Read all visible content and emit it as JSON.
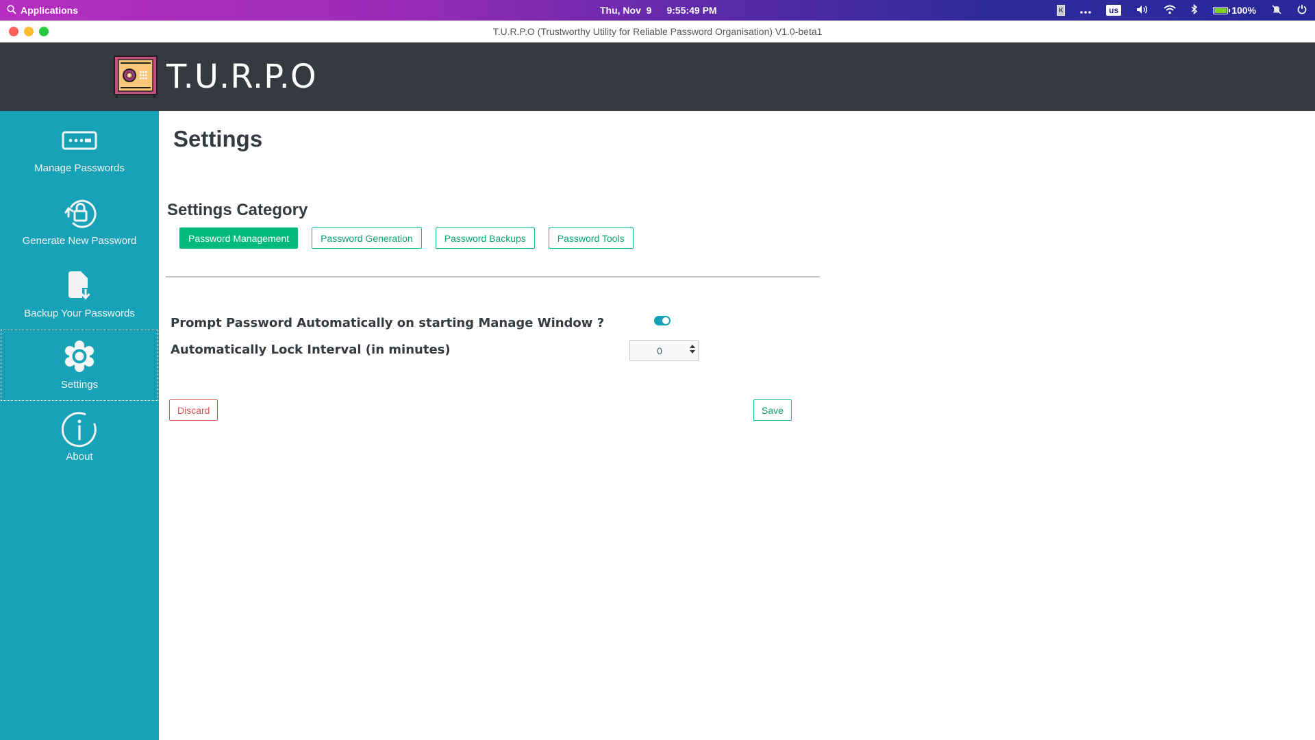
{
  "os_bar": {
    "applications_label": "Applications",
    "date": "Thu, Nov  9",
    "time": "9:55:49 PM",
    "keyboard_layout": "us",
    "k_indicator": "K",
    "battery_percent": "100%",
    "battery_level": 1.0,
    "icons": [
      "search-icon",
      "k-app-icon",
      "more-icon",
      "volume-icon",
      "wifi-icon",
      "bluetooth-icon",
      "battery-icon",
      "notifications-muted-icon",
      "power-icon"
    ]
  },
  "window": {
    "title": "T.U.R.P.O (Trustworthy Utility for Reliable Password Organisation) V1.0-beta1"
  },
  "header": {
    "brand": "T.U.R.P.O",
    "logo_icon": "safe-icon"
  },
  "sidebar": {
    "items": [
      {
        "label": "Manage Passwords",
        "icon": "password-field-icon",
        "active": false
      },
      {
        "label": "Generate New Password",
        "icon": "rotate-lock-icon",
        "active": false
      },
      {
        "label": "Backup Your Passwords",
        "icon": "file-download-icon",
        "active": false
      },
      {
        "label": "Settings",
        "icon": "gear-icon",
        "active": true
      },
      {
        "label": "About",
        "icon": "info-icon",
        "active": false
      }
    ]
  },
  "main": {
    "title": "Settings",
    "category_title": "Settings Category",
    "categories": [
      {
        "label": "Password Management",
        "active": true
      },
      {
        "label": "Password Generation",
        "active": false
      },
      {
        "label": "Password Backups",
        "active": false
      },
      {
        "label": "Password Tools",
        "active": false
      }
    ],
    "settings": {
      "prompt_password": {
        "label": "Prompt Password Automatically on starting Manage Window ?",
        "enabled": true
      },
      "lock_interval": {
        "label": "Automatically Lock Interval (in minutes)",
        "value": "0"
      }
    },
    "discard_label": "Discard",
    "save_label": "Save"
  },
  "colors": {
    "sidebar_bg": "#17a2b8",
    "header_bg": "#343a40",
    "accent_green": "#00b97a",
    "danger_red": "#d9534f",
    "toggle_on": "#17a2b8"
  }
}
